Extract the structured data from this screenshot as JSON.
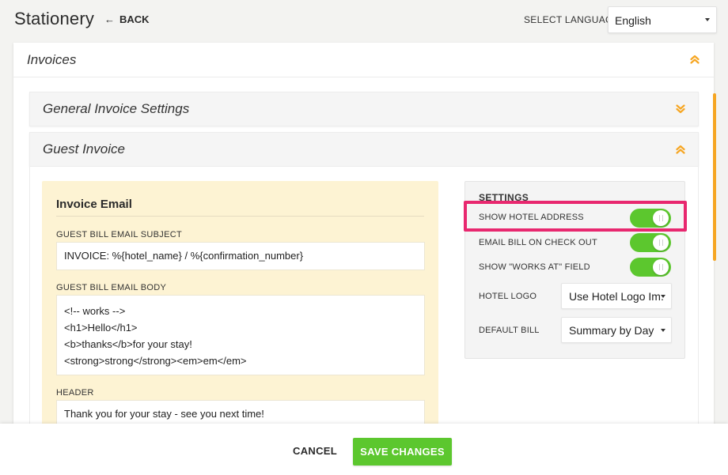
{
  "header": {
    "title": "Stationery",
    "back_label": "BACK",
    "language_label": "SELECT LANGUAGE",
    "language_value": "English"
  },
  "panel": {
    "title": "Invoices"
  },
  "sections": {
    "general": "General Invoice Settings",
    "guest": "Guest Invoice"
  },
  "invoice_email": {
    "title": "Invoice Email",
    "subject_label": "GUEST BILL EMAIL SUBJECT",
    "subject_value": "INVOICE: %{hotel_name} / %{confirmation_number}",
    "body_label": "GUEST BILL EMAIL BODY",
    "body_lines": [
      "<!-- works -->",
      "<h1>Hello</h1>",
      "<b>thanks</b>for your stay!",
      "<strong>strong</strong><em>em</em>"
    ],
    "header_label": "HEADER",
    "header_value": "Thank you for your stay - see you next time!"
  },
  "settings": {
    "title": "SETTINGS",
    "show_hotel_address": "SHOW HOTEL ADDRESS",
    "email_bill_on_checkout": "EMAIL BILL ON CHECK OUT",
    "show_works_at": "SHOW \"WORKS AT\" FIELD",
    "hotel_logo_label": "HOTEL LOGO",
    "hotel_logo_value": "Use Hotel Logo Im.",
    "default_bill_label": "DEFAULT BILL",
    "default_bill_value": "Summary by Day",
    "toggles": {
      "show_hotel_address": true,
      "email_bill_on_checkout": true,
      "show_works_at": true
    }
  },
  "footer": {
    "cancel_label": "CANCEL",
    "save_label": "SAVE CHANGES"
  },
  "colors": {
    "accent_green": "#5cc72e",
    "accent_orange": "#f6a623",
    "highlight_pink": "#e8286f",
    "card_yellow": "#fdf3d3"
  },
  "icons": {
    "back": "arrow-left-icon",
    "collapse": "double-chevron-up-icon",
    "expand": "double-chevron-down-icon",
    "dropdown": "caret-down-icon"
  }
}
